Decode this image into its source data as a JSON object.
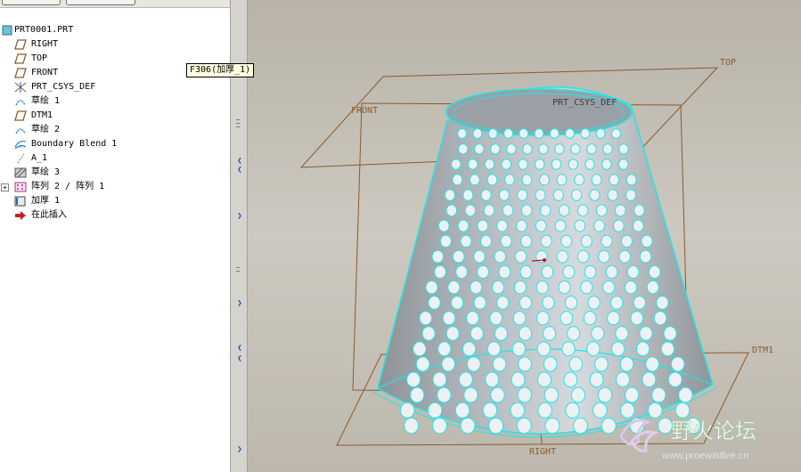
{
  "tree": {
    "root": "PRT0001.PRT",
    "items": [
      {
        "label": "RIGHT",
        "icon": "datum-plane-icon"
      },
      {
        "label": "TOP",
        "icon": "datum-plane-icon"
      },
      {
        "label": "FRONT",
        "icon": "datum-plane-icon"
      },
      {
        "label": "PRT_CSYS_DEF",
        "icon": "csys-icon"
      },
      {
        "label": "草绘 1",
        "icon": "sketch-icon"
      },
      {
        "label": "DTM1",
        "icon": "datum-plane-icon"
      },
      {
        "label": "草绘 2",
        "icon": "sketch-icon"
      },
      {
        "label": "Boundary Blend 1",
        "icon": "boundary-blend-icon"
      },
      {
        "label": "A_1",
        "icon": "axis-icon"
      },
      {
        "label": "草绘 3",
        "icon": "sketch-hatched-icon"
      },
      {
        "label": "阵列 2 / 阵列 1",
        "icon": "pattern-icon"
      },
      {
        "label": "加厚 1",
        "icon": "thicken-icon"
      },
      {
        "label": "在此插入",
        "icon": "insert-here-arrow-icon"
      }
    ]
  },
  "tooltip": "F306(加厚_1)",
  "viewport": {
    "datum_labels": {
      "top": "TOP",
      "front": "FRONT",
      "csys": "PRT_CSYS_DEF",
      "dtm1": "DTM1",
      "right": "RIGHT"
    }
  },
  "watermark": {
    "title": "野火论坛",
    "url": "www.proewildfire.cn"
  },
  "colors": {
    "model_edge": "#20e6e8",
    "datum": "#8a5a2a",
    "background": "#c4c0b6"
  }
}
